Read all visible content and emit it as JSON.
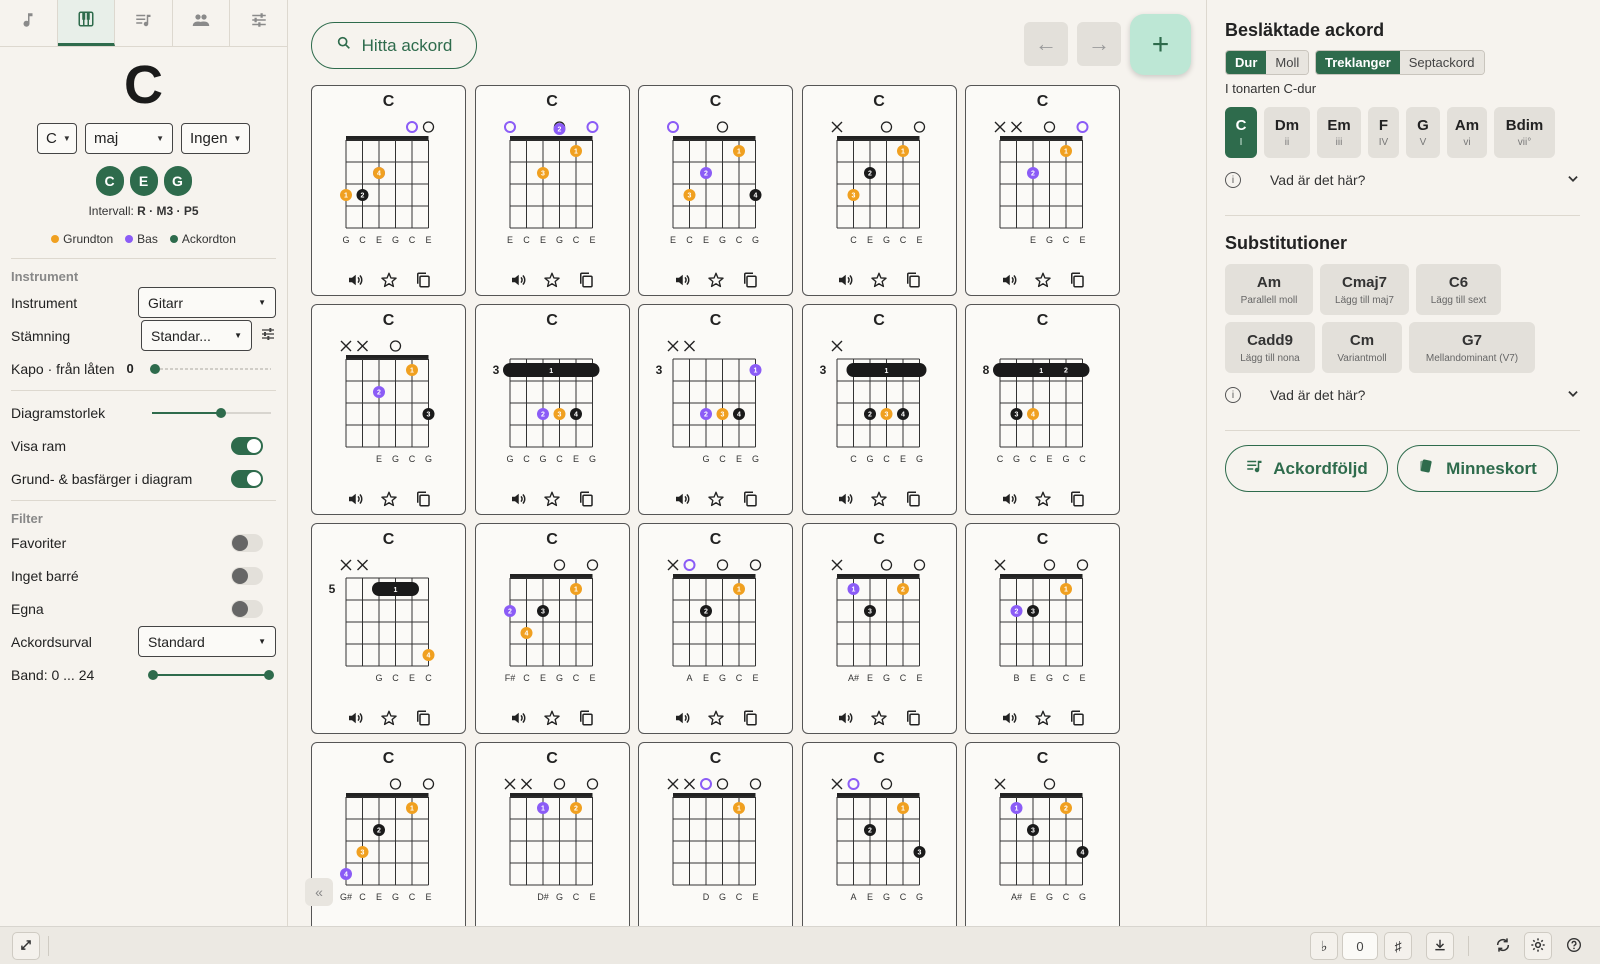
{
  "sidebar": {
    "tabs": [
      {
        "name": "music-note-icon"
      },
      {
        "name": "piano-icon"
      },
      {
        "name": "playlist-icon"
      },
      {
        "name": "people-icon"
      },
      {
        "name": "sliders-icon"
      }
    ],
    "chord_name": "C",
    "root_select": "C",
    "quality_select": "maj",
    "bass_select": "Ingen",
    "notes": [
      "C",
      "E",
      "G"
    ],
    "intervals_label": "Intervall:",
    "intervals_value": "R · M3 · P5",
    "legend": [
      {
        "label": "Grundton",
        "color": "#f0a020"
      },
      {
        "label": "Bas",
        "color": "#8b5cf6"
      },
      {
        "label": "Ackordton",
        "color": "#2e6b4c"
      }
    ],
    "instrument_section": "Instrument",
    "instrument_label": "Instrument",
    "instrument_value": "Gitarr",
    "tuning_label": "Stämning",
    "tuning_value": "Standar...",
    "capo_label": "Kapo · från låten",
    "capo_value": "0",
    "diagram_size_label": "Diagramstorlek",
    "diagram_size_value": 0.58,
    "show_frame_label": "Visa ram",
    "root_bass_colors_label": "Grund- & basfärger i diagram",
    "filter_section": "Filter",
    "favorites_label": "Favoriter",
    "no_barre_label": "Inget barré",
    "own_label": "Egna",
    "selection_label": "Ackordsurval",
    "selection_value": "Standard",
    "frets_label": "Band: 0 ... 24"
  },
  "main": {
    "find_label": "Hitta ackord",
    "add_label": "+",
    "chord_label": "C"
  },
  "colors": {
    "accent": "#2e6b4c",
    "root": "#f0a020",
    "bass": "#8b5cf6",
    "tone": "#1a1a1a"
  },
  "voicings": [
    {
      "top": [
        null,
        null,
        null,
        null,
        "bass",
        "open"
      ],
      "pos": 1,
      "barre": null,
      "dots": [
        [
          2,
          "3",
          "bass"
        ],
        [
          2,
          "4",
          "root"
        ],
        [
          1,
          "2",
          "tone"
        ],
        [
          0,
          "1",
          "root"
        ]
      ],
      "fr": [
        3,
        3,
        2,
        0,
        1,
        0
      ],
      "bottom": "G C E G C E"
    },
    {
      "top": [
        "bass",
        null,
        null,
        "open",
        null,
        "bass"
      ],
      "pos": 1,
      "barre": null,
      "dots": [
        [
          3,
          "2",
          "bass"
        ],
        [
          4,
          "1",
          "root"
        ],
        [
          2,
          "3",
          "root"
        ]
      ],
      "fr": [
        0,
        3,
        2,
        0,
        1,
        0
      ],
      "bottom": "E C E G C E"
    },
    {
      "top": [
        "bass",
        null,
        null,
        "open",
        null,
        null
      ],
      "pos": 1,
      "barre": null,
      "dots": [
        [
          1,
          "3",
          "root"
        ],
        [
          2,
          "2",
          "bass"
        ],
        [
          4,
          "1",
          "root"
        ],
        [
          5,
          "4",
          "tone"
        ]
      ],
      "fr": [
        0,
        3,
        2,
        0,
        1,
        3
      ],
      "bottom": "E C E G C G"
    },
    {
      "top": [
        "x",
        null,
        null,
        "open",
        null,
        "open"
      ],
      "pos": 1,
      "barre": null,
      "dots": [
        [
          1,
          "3",
          "root"
        ],
        [
          2,
          "2",
          "tone"
        ],
        [
          4,
          "1",
          "root"
        ]
      ],
      "fr": [
        -1,
        3,
        2,
        0,
        1,
        0
      ],
      "bottom": "C E G C E"
    },
    {
      "top": [
        "x",
        "x",
        null,
        "open",
        null,
        "bass"
      ],
      "pos": 1,
      "barre": null,
      "dots": [
        [
          2,
          "2",
          "bass"
        ],
        [
          4,
          "1",
          "root"
        ]
      ],
      "fr": [
        -1,
        -1,
        2,
        0,
        1,
        0
      ],
      "bottom": "E G C E"
    },
    {
      "top": [
        "x",
        "x",
        null,
        "open",
        null,
        null
      ],
      "pos": 1,
      "barre": null,
      "dots": [
        [
          2,
          "2",
          "bass"
        ],
        [
          4,
          "1",
          "root"
        ],
        [
          5,
          "3",
          "tone"
        ]
      ],
      "fr": [
        -1,
        -1,
        2,
        0,
        1,
        3
      ],
      "bottom": "E G C G"
    },
    {
      "top": [
        null,
        null,
        null,
        null,
        null,
        null
      ],
      "pos": 3,
      "barre": {
        "fret": 1,
        "from": 0,
        "to": 5
      },
      "dots": [
        [
          2,
          "2",
          "bass"
        ],
        [
          3,
          "3",
          "root"
        ],
        [
          4,
          "4",
          "tone"
        ]
      ],
      "fr": [
        3,
        3,
        5,
        5,
        5,
        3
      ],
      "bottom": "G C G C E G"
    },
    {
      "top": [
        "x",
        "x",
        null,
        null,
        null,
        null
      ],
      "pos": 3,
      "barre": null,
      "dots": [
        [
          5,
          "1",
          "bass"
        ],
        [
          2,
          "2",
          "bass"
        ],
        [
          3,
          "3",
          "root"
        ],
        [
          4,
          "4",
          "tone"
        ]
      ],
      "fr": [
        -1,
        -1,
        5,
        5,
        5,
        3
      ],
      "bottom": "G C E G"
    },
    {
      "top": [
        "x",
        null,
        null,
        null,
        null,
        null
      ],
      "pos": 3,
      "barre": {
        "fret": 1,
        "from": 1,
        "to": 5
      },
      "dots": [
        [
          2,
          "2",
          "tone"
        ],
        [
          3,
          "3",
          "root"
        ],
        [
          4,
          "4",
          "tone"
        ]
      ],
      "fr": [
        -1,
        3,
        5,
        5,
        5,
        3
      ],
      "bottom": "C G C E G"
    },
    {
      "top": [
        null,
        null,
        null,
        null,
        null,
        null
      ],
      "pos": 8,
      "barre": {
        "fret": 1,
        "from": 0,
        "to": 5
      },
      "dots": [
        [
          4,
          "2",
          "tone"
        ],
        [
          1,
          "3",
          "tone"
        ],
        [
          2,
          "4",
          "root"
        ]
      ],
      "fr": [
        8,
        10,
        10,
        9,
        8,
        8
      ],
      "bottom": "C G C E G C"
    },
    {
      "top": [
        "x",
        "x",
        null,
        null,
        null,
        null
      ],
      "pos": 5,
      "barre": {
        "fret": 1,
        "from": 2,
        "to": 4
      },
      "dots": [
        [
          5,
          "4",
          "root"
        ]
      ],
      "fr": [
        -1,
        -1,
        5,
        5,
        5,
        8
      ],
      "bottom": "G C E C"
    },
    {
      "top": [
        null,
        null,
        null,
        "open",
        null,
        "open"
      ],
      "pos": 1,
      "barre": null,
      "dots": [
        [
          0,
          "2",
          "bass"
        ],
        [
          1,
          "4",
          "root"
        ],
        [
          2,
          "3",
          "tone"
        ],
        [
          4,
          "1",
          "root"
        ]
      ],
      "fr": [
        2,
        3,
        2,
        0,
        1,
        0
      ],
      "bottom": "F# C E G C E"
    },
    {
      "top": [
        "x",
        "bass",
        null,
        "open",
        null,
        "open"
      ],
      "pos": 1,
      "barre": null,
      "dots": [
        [
          2,
          "2",
          "tone"
        ],
        [
          4,
          "1",
          "root"
        ]
      ],
      "fr": [
        -1,
        0,
        2,
        0,
        1,
        0
      ],
      "bottom": "A E G C E"
    },
    {
      "top": [
        "x",
        null,
        null,
        "open",
        null,
        "open"
      ],
      "pos": 1,
      "barre": null,
      "dots": [
        [
          1,
          "1",
          "bass"
        ],
        [
          2,
          "3",
          "tone"
        ],
        [
          4,
          "2",
          "root"
        ]
      ],
      "fr": [
        -1,
        1,
        2,
        0,
        1,
        0
      ],
      "bottom": "A# E G C E"
    },
    {
      "top": [
        "x",
        null,
        null,
        "open",
        null,
        "open"
      ],
      "pos": 1,
      "barre": null,
      "dots": [
        [
          1,
          "2",
          "bass"
        ],
        [
          2,
          "3",
          "tone"
        ],
        [
          4,
          "1",
          "root"
        ]
      ],
      "fr": [
        -1,
        2,
        2,
        0,
        1,
        0
      ],
      "bottom": "B E G C E"
    },
    {
      "top": [
        null,
        null,
        null,
        "open",
        null,
        "open"
      ],
      "pos": 1,
      "barre": null,
      "dots": [
        [
          0,
          "4",
          "bass"
        ],
        [
          1,
          "3",
          "root"
        ],
        [
          2,
          "2",
          "tone"
        ],
        [
          4,
          "1",
          "root"
        ]
      ],
      "fr": [
        4,
        3,
        2,
        0,
        1,
        0
      ],
      "bottom": "G# C E G C E"
    },
    {
      "top": [
        "x",
        "x",
        null,
        "open",
        null,
        "open"
      ],
      "pos": 1,
      "barre": null,
      "dots": [
        [
          2,
          "1",
          "bass"
        ],
        [
          4,
          "2",
          "root"
        ]
      ],
      "fr": [
        -1,
        -1,
        1,
        0,
        1,
        0
      ],
      "bottom": "D# G C E"
    },
    {
      "top": [
        "x",
        "x",
        "bass",
        "open",
        null,
        "open"
      ],
      "pos": 1,
      "barre": null,
      "dots": [
        [
          4,
          "1",
          "root"
        ]
      ],
      "fr": [
        -1,
        -1,
        0,
        0,
        1,
        0
      ],
      "bottom": "D G C E"
    },
    {
      "top": [
        "x",
        "bass",
        null,
        "open",
        null,
        null
      ],
      "pos": 1,
      "barre": null,
      "dots": [
        [
          2,
          "2",
          "tone"
        ],
        [
          4,
          "1",
          "root"
        ],
        [
          5,
          "3",
          "tone"
        ]
      ],
      "fr": [
        -1,
        0,
        2,
        0,
        1,
        3
      ],
      "bottom": "A E G C G"
    },
    {
      "top": [
        "x",
        null,
        null,
        "open",
        null,
        null
      ],
      "pos": 1,
      "barre": null,
      "dots": [
        [
          1,
          "1",
          "bass"
        ],
        [
          2,
          "3",
          "tone"
        ],
        [
          4,
          "2",
          "root"
        ],
        [
          5,
          "4",
          "tone"
        ]
      ],
      "fr": [
        -1,
        1,
        2,
        0,
        1,
        3
      ],
      "bottom": "A# E G C G"
    }
  ],
  "right": {
    "related_title": "Besläktade ackord",
    "seg1": [
      "Dur",
      "Moll"
    ],
    "seg2": [
      "Treklanger",
      "Septackord"
    ],
    "key_label": "I tonarten C-dur",
    "diatonic": [
      {
        "n": "C",
        "r": "I"
      },
      {
        "n": "Dm",
        "r": "ii"
      },
      {
        "n": "Em",
        "r": "iii"
      },
      {
        "n": "F",
        "r": "IV"
      },
      {
        "n": "G",
        "r": "V"
      },
      {
        "n": "Am",
        "r": "vi"
      },
      {
        "n": "Bdim",
        "r": "vii°"
      }
    ],
    "what_is_this": "Vad är det här?",
    "subst_title": "Substitutioner",
    "substitutions": [
      {
        "n": "Am",
        "d": "Parallell moll"
      },
      {
        "n": "Cmaj7",
        "d": "Lägg till maj7"
      },
      {
        "n": "C6",
        "d": "Lägg till sext"
      },
      {
        "n": "Cadd9",
        "d": "Lägg till nona"
      },
      {
        "n": "Cm",
        "d": "Variantmoll"
      },
      {
        "n": "G7",
        "d": "Mellandominant (V7)"
      }
    ],
    "progression_btn": "Ackordföljd",
    "flashcards_btn": "Minneskort"
  },
  "bottombar": {
    "flat": "♭",
    "transpose_value": "0",
    "sharp": "♯"
  }
}
